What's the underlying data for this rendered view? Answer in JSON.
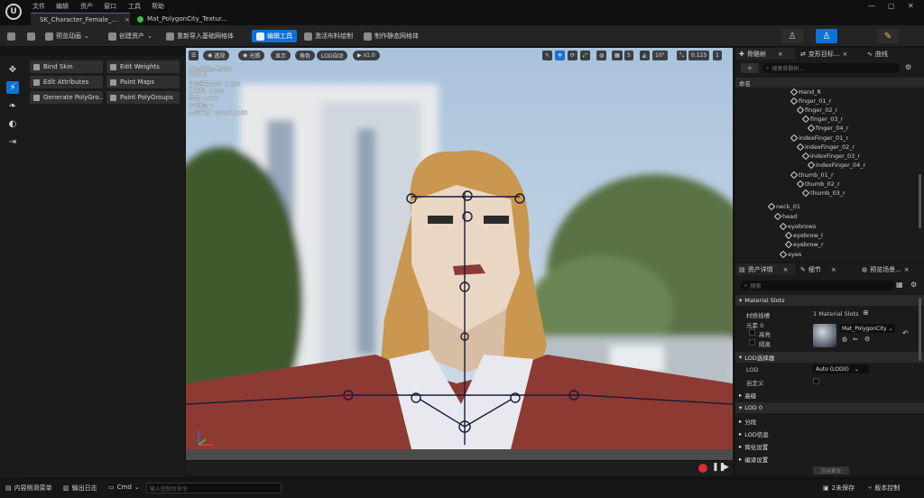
{
  "menu": [
    "文件",
    "编辑",
    "资产",
    "窗口",
    "工具",
    "帮助"
  ],
  "tabs": [
    {
      "label": "SK_Character_Female_...",
      "active": true
    },
    {
      "label": "Mat_PolygonCity_Textur...",
      "active": false
    }
  ],
  "toolbar": {
    "preview_anim": "预览动画",
    "create_asset": "创建资产",
    "reimport": "重新导入基础网格体",
    "edit_tools": "编辑工具",
    "cloth_paint": "激活布料绘制",
    "make_static": "制作静态网格体"
  },
  "tool_panel": {
    "buttons": [
      "Bind Skin",
      "Edit Weights",
      "Edit Attributes",
      "Paint Maps",
      "Generate PolyGro...",
      "Paint PolyGroups"
    ]
  },
  "viewport": {
    "toolbar_left": [
      "透视",
      "光照",
      "显示",
      "角色",
      "LOD自动",
      "x1.0"
    ],
    "toolbar_right": [
      "5",
      "10°",
      "0.125",
      "1"
    ],
    "stats": [
      "正在预览参考姿势",
      "LOD: 0",
      "当前屏幕大小: 3.264",
      "三角形: 1,005",
      "顶点: 4,452",
      "UV通道: 2",
      "大约尺寸: 204x41x185"
    ]
  },
  "skeleton_panel": {
    "tabs": [
      "骨骼树",
      "变形目标...",
      "曲线"
    ],
    "search_placeholder": "搜索骨骼树...",
    "column": "命名",
    "bones": [
      {
        "name": "Hand_R",
        "depth": 5
      },
      {
        "name": "finger_01_r",
        "depth": 6
      },
      {
        "name": "finger_02_r",
        "depth": 7
      },
      {
        "name": "finger_03_r",
        "depth": 8
      },
      {
        "name": "finger_04_r",
        "depth": 9
      },
      {
        "name": "indexFinger_01_r",
        "depth": 6
      },
      {
        "name": "indexFinger_02_r",
        "depth": 7
      },
      {
        "name": "indexFinger_03_r",
        "depth": 8
      },
      {
        "name": "indexFinger_04_r",
        "depth": 9
      },
      {
        "name": "thumb_01_r",
        "depth": 6
      },
      {
        "name": "thumb_02_r",
        "depth": 7
      },
      {
        "name": "thumb_03_r",
        "depth": 8
      },
      {
        "name": "neck_01",
        "depth": 1
      },
      {
        "name": "head",
        "depth": 2
      },
      {
        "name": "eyebrows",
        "depth": 3
      },
      {
        "name": "eyebrow_l",
        "depth": 4
      },
      {
        "name": "eyebrow_r",
        "depth": 4
      },
      {
        "name": "eyes",
        "depth": 3
      }
    ]
  },
  "details_panel": {
    "tabs": [
      "资产详情",
      "细节",
      "预览场景..."
    ],
    "search_placeholder": "搜索",
    "material_slots_title": "Material Slots",
    "material_slots_label": "材质插槽",
    "material_slots_count": "1 Material Slots",
    "element_label": "元素 0",
    "highlight_label": "高亮",
    "isolate_label": "隔离",
    "material_name": "Mat_PolygonCity",
    "lod_selector_title": "LOD选择器",
    "lod_label": "LOD",
    "lod_value": "Auto (LOD0)",
    "custom_label": "自定义",
    "advanced_title": "高级",
    "lod0_title": "LOD 0",
    "lod0_rows": [
      "分段",
      "LOD信息",
      "简化设置",
      "编译设置"
    ],
    "apply_button": "应用更改"
  },
  "statusbar": {
    "content_drawer": "内容侧滑菜单",
    "output_log": "输出日志",
    "cmd": "Cmd",
    "console_placeholder": "输入控制台命令",
    "unsaved": "2未保存",
    "source_control": "版本控制"
  },
  "colors": {
    "accent": "#0d72d6",
    "ue_purple": "#6e4fb0"
  }
}
